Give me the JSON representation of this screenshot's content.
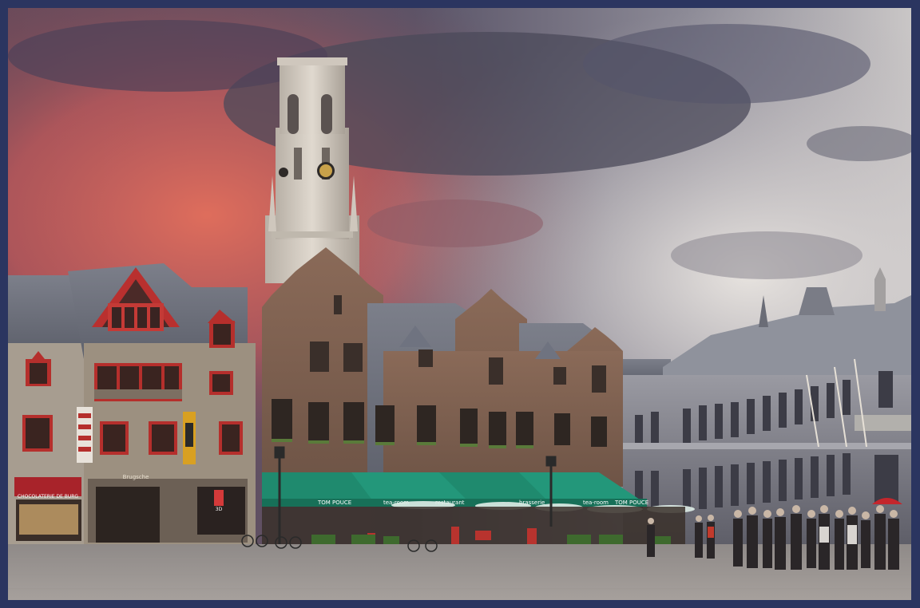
{
  "scene": {
    "sky_colors": {
      "sunset": "#d8695a",
      "storm": "#4a4a5c",
      "light": "#d9d4d0"
    },
    "frame_color": "#2b3560",
    "awning_color": "#1f8a6e",
    "awning_labels": [
      "TOM POUCE",
      "tea-room",
      "restaurant",
      "brasserie",
      "tea-room",
      "TOM POUCE"
    ],
    "shop_sign": "CHOCOLATERIE DE BURG",
    "shop_sign_2": "Brugsche",
    "banner_left_text": "Brugge",
    "info_sign": "3D"
  }
}
